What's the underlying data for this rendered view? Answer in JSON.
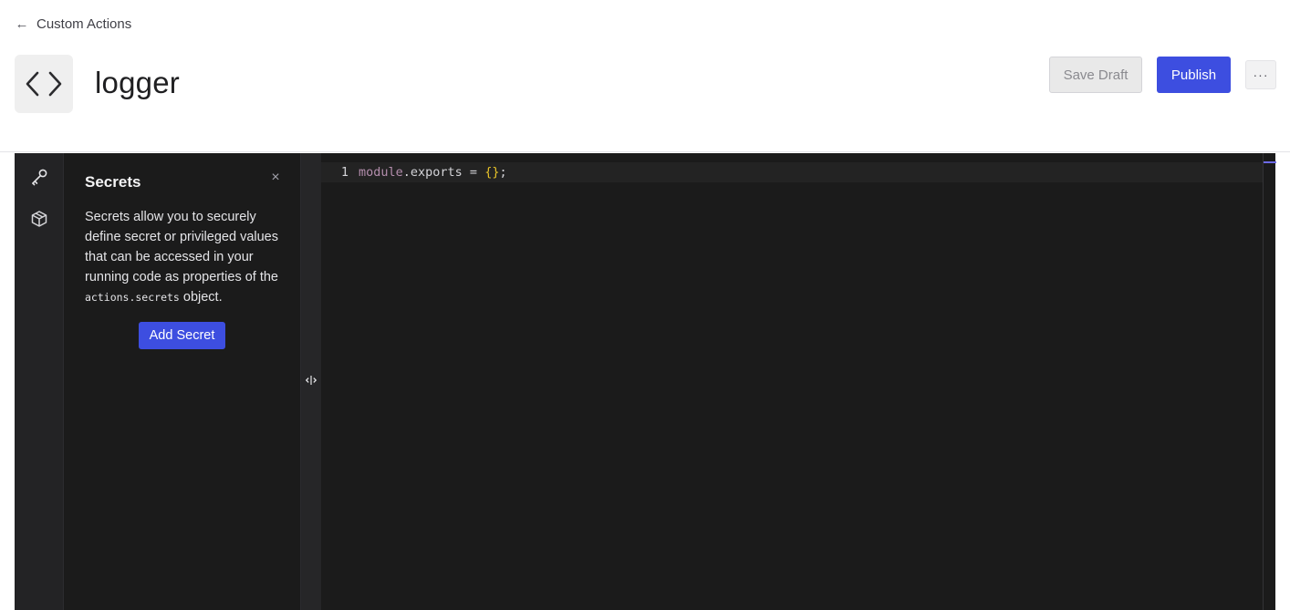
{
  "nav": {
    "back_label": "Custom Actions"
  },
  "header": {
    "title": "logger",
    "icon": "code-brackets-icon",
    "save_draft_label": "Save Draft",
    "publish_label": "Publish",
    "more_label": "···"
  },
  "sidebar": {
    "items": [
      {
        "name": "key-icon",
        "active": true
      },
      {
        "name": "package-icon",
        "active": false
      }
    ]
  },
  "secrets_panel": {
    "title": "Secrets",
    "close_label": "×",
    "desc_before": "Secrets allow you to securely define secret or privileged values that can be accessed in your running code as properties of the ",
    "desc_code": "actions.secrets",
    "desc_after": " object.",
    "add_button_label": "Add Secret"
  },
  "editor": {
    "line_number": "1",
    "tokens": {
      "module": "module",
      "dot_exports": ".exports = ",
      "braces": "{}",
      "semicolon": ";"
    }
  },
  "colors": {
    "accent": "#3d4ee0",
    "editor_bg": "#1b1b1b",
    "keyword": "#b48ead",
    "brace": "#e6c229"
  }
}
